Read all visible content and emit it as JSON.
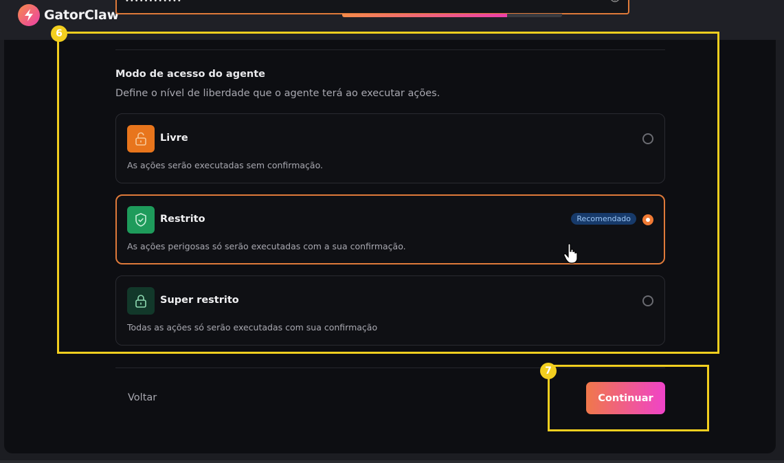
{
  "app": {
    "name": "GatorClaw"
  },
  "previous_field": {
    "masked_value": "••••••••••••"
  },
  "progress": {
    "fraction": 0.75
  },
  "section": {
    "title": "Modo de acesso do agente",
    "description": "Define o nível de liberdade que o agente terá ao executar ações."
  },
  "options": [
    {
      "title": "Livre",
      "description": "As ações serão executadas sem confirmação.",
      "icon": "unlock-icon",
      "color": "#e8751c",
      "selected": false
    },
    {
      "title": "Restrito",
      "description": "As ações perigosas só serão executadas com a sua confirmação.",
      "icon": "shield-check-icon",
      "color": "#1e9b5b",
      "selected": true,
      "badge": "Recomendado"
    },
    {
      "title": "Super restrito",
      "description": "Todas as ações só serão executadas com sua confirmação",
      "icon": "lock-icon",
      "color": "#12382a",
      "selected": false
    }
  ],
  "annotations": {
    "step_6": "6",
    "step_7": "7"
  },
  "footer": {
    "back_label": "Voltar",
    "continue_label": "Continuar"
  },
  "colors": {
    "accent": "#e07a3a",
    "annotation": "#f3cf1f",
    "badge_bg": "#173a6a"
  }
}
